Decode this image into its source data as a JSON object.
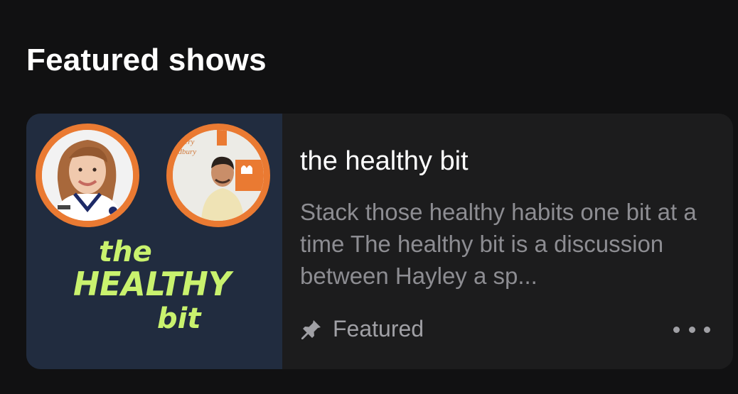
{
  "section": {
    "title": "Featured shows"
  },
  "show": {
    "title": "the healthy bit",
    "description": "Stack those healthy habits one bit at a time The healthy bit is a discussion between Hayley a sp...",
    "tag_label": "Featured",
    "tag_icon": "pin-icon",
    "more_icon": "more-horizontal-icon",
    "artwork": {
      "wordmark_lines": [
        "the",
        "HEALTHY",
        "bit"
      ],
      "sign_text": [
        "akery",
        "udbury"
      ],
      "accent_color": "#ea7a32",
      "wordmark_color": "#c9f26e",
      "background_color": "#212c3f"
    }
  }
}
